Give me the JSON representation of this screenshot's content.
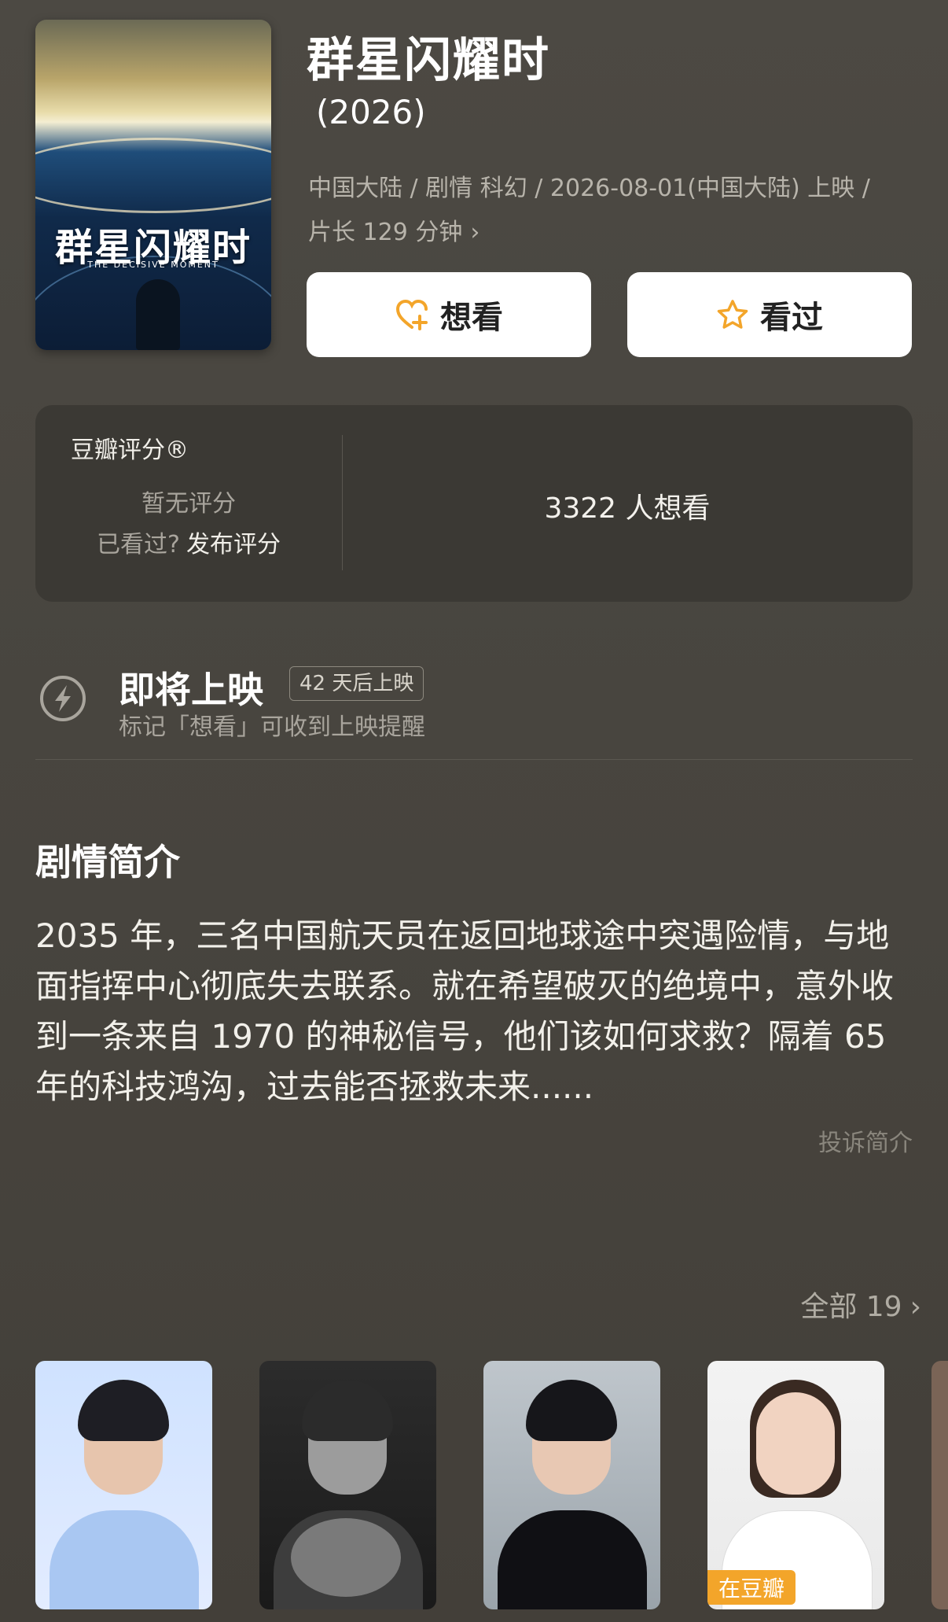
{
  "movie": {
    "title": "群星闪耀时",
    "year": " (2026)",
    "meta_line1": "中国大陆 / 剧情 科幻 / 2026-08-01(中国大陆) 上映 /",
    "meta_line2": "片长 129 分钟",
    "poster": {
      "title": "群星闪耀时",
      "subtitle": "THE DECISIVE MOMENT"
    }
  },
  "actions": {
    "want_label": "想看",
    "seen_label": "看过"
  },
  "rating": {
    "label": "豆瓣评分®",
    "no_rating": "暂无评分",
    "seen_prompt": "已看过?",
    "publish_link": "发布评分",
    "wish_count_text": "3322 人想看"
  },
  "coming_soon": {
    "heading": "即将上映",
    "badge": "42 天后上映",
    "hint": "标记「想看」可收到上映提醒"
  },
  "synopsis": {
    "title": "剧情简介",
    "text": "2035 年，三名中国航天员在返回地球途中突遇险情，与地面指挥中心彻底失去联系。就在希望破灭的绝境中，意外收到一条来自 1970 的神秘信号，他们该如何求救？隔着 65 年的科技鸿沟，过去能否拯救未来......",
    "complain": "投诉简介"
  },
  "cast": {
    "all_label": "全部 19",
    "badge": "在豆瓣"
  },
  "colors": {
    "background": "#4a4741",
    "card": "#3b3934",
    "accent": "#f3a52a"
  }
}
